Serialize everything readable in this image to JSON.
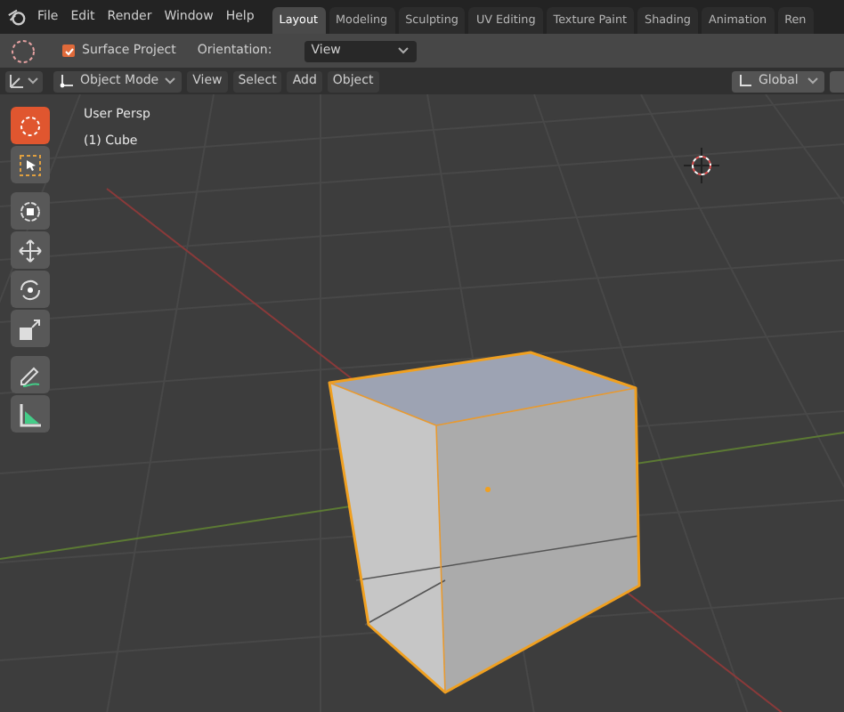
{
  "menu": [
    "File",
    "Edit",
    "Render",
    "Window",
    "Help"
  ],
  "workspace_tabs": [
    {
      "label": "Layout",
      "selected": true
    },
    {
      "label": "Modeling",
      "selected": false
    },
    {
      "label": "Sculpting",
      "selected": false
    },
    {
      "label": "UV Editing",
      "selected": false
    },
    {
      "label": "Texture Paint",
      "selected": false
    },
    {
      "label": "Shading",
      "selected": false
    },
    {
      "label": "Animation",
      "selected": false
    },
    {
      "label": "Ren",
      "selected": false
    }
  ],
  "tool_settings": {
    "surface_project": {
      "label": "Surface Project",
      "checked": true
    },
    "orientation_label": "Orientation:",
    "orientation_value": "View"
  },
  "header": {
    "mode": "Object Mode",
    "menus": [
      "View",
      "Select",
      "Add",
      "Object"
    ],
    "transform": "Global"
  },
  "toolbar": [
    {
      "kind": "annotate",
      "selected": true
    },
    {
      "kind": "select",
      "selected": false
    },
    {
      "kind": "cursor",
      "selected": false
    },
    {
      "kind": "move",
      "selected": false
    },
    {
      "kind": "rotate",
      "selected": false
    },
    {
      "kind": "scale",
      "selected": false
    },
    {
      "kind": "draw",
      "selected": false
    },
    {
      "kind": "measure",
      "selected": false
    }
  ],
  "viewport": {
    "view_name": "User Persp",
    "object_name": "(1) Cube"
  }
}
